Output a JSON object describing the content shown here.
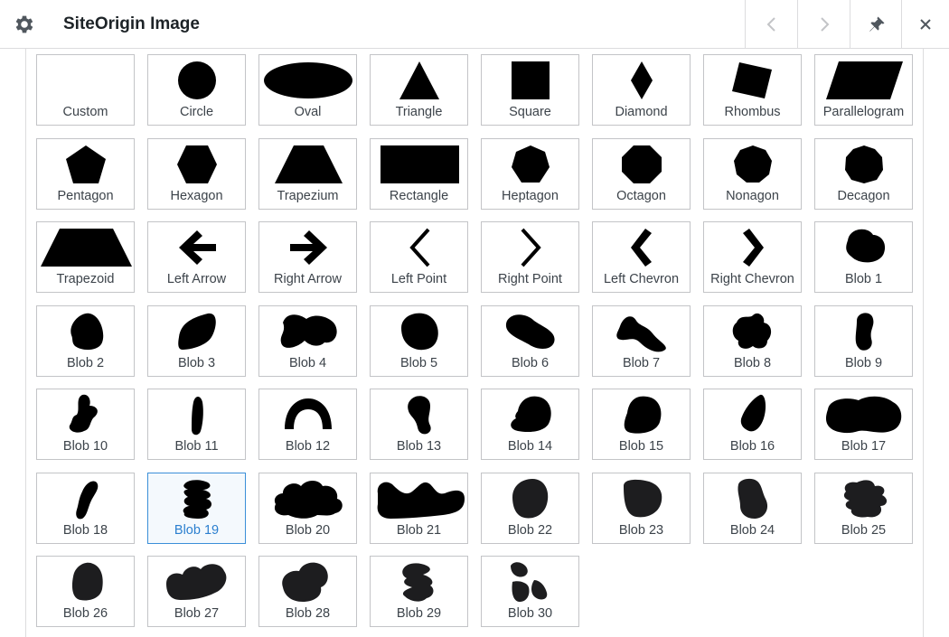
{
  "dialog": {
    "title": "SiteOrigin Image",
    "icons": {
      "settings": "gear-icon",
      "prev": "chevron-left-icon",
      "next": "chevron-right-icon",
      "pin": "pushpin-icon",
      "close": "close-icon"
    }
  },
  "colors": {
    "border": "#c3c4c7",
    "selected_border": "#3b8fd8",
    "selected_label": "#2b7fcf",
    "shape_fill": "#000000"
  },
  "shapes": [
    {
      "label": "Custom",
      "icon": "none"
    },
    {
      "label": "Circle",
      "icon": "circle-shape"
    },
    {
      "label": "Oval",
      "icon": "oval-shape"
    },
    {
      "label": "Triangle",
      "icon": "triangle-shape"
    },
    {
      "label": "Square",
      "icon": "square-shape"
    },
    {
      "label": "Diamond",
      "icon": "diamond-shape"
    },
    {
      "label": "Rhombus",
      "icon": "rhombus-shape"
    },
    {
      "label": "Parallelogram",
      "icon": "parallelogram-shape"
    },
    {
      "label": "Pentagon",
      "icon": "pentagon-shape"
    },
    {
      "label": "Hexagon",
      "icon": "hexagon-shape"
    },
    {
      "label": "Trapezium",
      "icon": "trapezium-shape"
    },
    {
      "label": "Rectangle",
      "icon": "rectangle-shape"
    },
    {
      "label": "Heptagon",
      "icon": "heptagon-shape"
    },
    {
      "label": "Octagon",
      "icon": "octagon-shape"
    },
    {
      "label": "Nonagon",
      "icon": "nonagon-shape"
    },
    {
      "label": "Decagon",
      "icon": "decagon-shape"
    },
    {
      "label": "Trapezoid",
      "icon": "trapezoid-shape"
    },
    {
      "label": "Left Arrow",
      "icon": "left-arrow-shape"
    },
    {
      "label": "Right Arrow",
      "icon": "right-arrow-shape"
    },
    {
      "label": "Left Point",
      "icon": "left-point-shape"
    },
    {
      "label": "Right Point",
      "icon": "right-point-shape"
    },
    {
      "label": "Left Chevron",
      "icon": "left-chevron-shape"
    },
    {
      "label": "Right Chevron",
      "icon": "right-chevron-shape"
    },
    {
      "label": "Blob 1",
      "icon": "blob-shape"
    },
    {
      "label": "Blob 2",
      "icon": "blob-shape"
    },
    {
      "label": "Blob 3",
      "icon": "blob-shape"
    },
    {
      "label": "Blob 4",
      "icon": "blob-shape"
    },
    {
      "label": "Blob 5",
      "icon": "blob-shape"
    },
    {
      "label": "Blob 6",
      "icon": "blob-shape"
    },
    {
      "label": "Blob 7",
      "icon": "blob-shape"
    },
    {
      "label": "Blob 8",
      "icon": "blob-shape"
    },
    {
      "label": "Blob 9",
      "icon": "blob-shape"
    },
    {
      "label": "Blob 10",
      "icon": "blob-shape"
    },
    {
      "label": "Blob 11",
      "icon": "blob-shape"
    },
    {
      "label": "Blob 12",
      "icon": "blob-shape"
    },
    {
      "label": "Blob 13",
      "icon": "blob-shape"
    },
    {
      "label": "Blob 14",
      "icon": "blob-shape"
    },
    {
      "label": "Blob 15",
      "icon": "blob-shape"
    },
    {
      "label": "Blob 16",
      "icon": "blob-shape"
    },
    {
      "label": "Blob 17",
      "icon": "blob-shape"
    },
    {
      "label": "Blob 18",
      "icon": "blob-shape"
    },
    {
      "label": "Blob 19",
      "icon": "blob-shape",
      "selected": true
    },
    {
      "label": "Blob 20",
      "icon": "blob-shape"
    },
    {
      "label": "Blob 21",
      "icon": "blob-shape"
    },
    {
      "label": "Blob 22",
      "icon": "blob-shape"
    },
    {
      "label": "Blob 23",
      "icon": "blob-shape"
    },
    {
      "label": "Blob 24",
      "icon": "blob-shape"
    },
    {
      "label": "Blob 25",
      "icon": "blob-shape"
    },
    {
      "label": "Blob 26",
      "icon": "blob-shape"
    },
    {
      "label": "Blob 27",
      "icon": "blob-shape"
    },
    {
      "label": "Blob 28",
      "icon": "blob-shape"
    },
    {
      "label": "Blob 29",
      "icon": "blob-shape"
    },
    {
      "label": "Blob 30",
      "icon": "blob-shape"
    }
  ]
}
